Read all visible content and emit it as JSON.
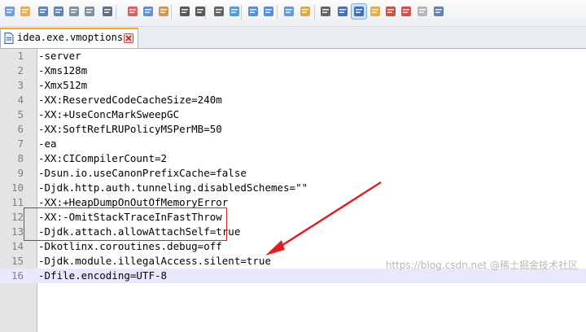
{
  "toolbar": {
    "icons": [
      "new-file-icon",
      "open-file-icon",
      "save-icon",
      "save-all-icon",
      "close-icon",
      "close-all-icon",
      "print-icon",
      "cut-icon",
      "copy-icon",
      "paste-icon",
      "undo-icon",
      "redo-icon",
      "find-icon",
      "replace-icon",
      "zoom-in-icon",
      "zoom-out-icon",
      "sync-vertical-icon",
      "sync-horizontal-icon",
      "word-wrap-icon",
      "show-all-chars-icon",
      "indent-guide-icon",
      "function-list-icon",
      "document-map-icon",
      "macro-record-icon",
      "macro-stop-icon",
      "macro-play-icon"
    ]
  },
  "tab": {
    "label": "idea.exe.vmoptions"
  },
  "lines": [
    {
      "n": "1",
      "text": "-server"
    },
    {
      "n": "2",
      "text": "-Xms128m"
    },
    {
      "n": "3",
      "text": "-Xmx512m"
    },
    {
      "n": "4",
      "text": "-XX:ReservedCodeCacheSize=240m"
    },
    {
      "n": "5",
      "text": "-XX:+UseConcMarkSweepGC"
    },
    {
      "n": "6",
      "text": "-XX:SoftRefLRUPolicyMSPerMB=50"
    },
    {
      "n": "7",
      "text": "-ea"
    },
    {
      "n": "8",
      "text": "-XX:CICompilerCount=2"
    },
    {
      "n": "9",
      "text": "-Dsun.io.useCanonPrefixCache=false"
    },
    {
      "n": "10",
      "text": "-Djdk.http.auth.tunneling.disabledSchemes=\"\""
    },
    {
      "n": "11",
      "text": "-XX:+HeapDumpOnOutOfMemoryError"
    },
    {
      "n": "12",
      "text": "-XX:-OmitStackTraceInFastThrow"
    },
    {
      "n": "13",
      "text": "-Djdk.attach.allowAttachSelf=true"
    },
    {
      "n": "14",
      "text": "-Dkotlinx.coroutines.debug=off"
    },
    {
      "n": "15",
      "text": "-Djdk.module.illegalAccess.silent=true"
    },
    {
      "n": "16",
      "text": "-Dfile.encoding=UTF-8"
    }
  ],
  "current_line": 16,
  "colors": {
    "highlight_box": "#e02020",
    "arrow": "#e02020",
    "current_line_bg": "#e8e8ff"
  },
  "watermark": "https://blog.csdn.net @稀土掘金技术社区"
}
